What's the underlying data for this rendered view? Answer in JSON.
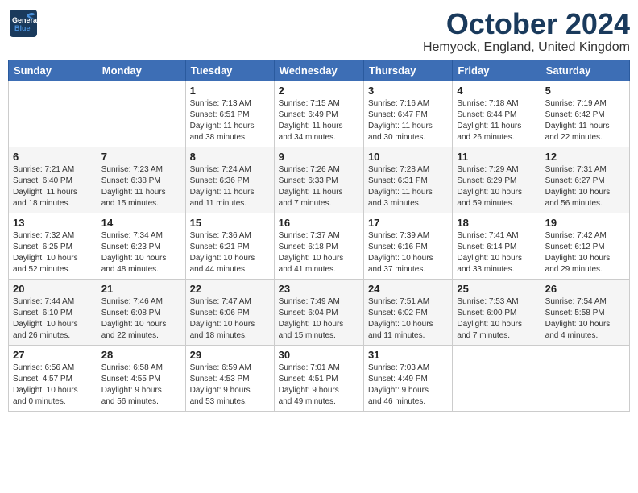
{
  "header": {
    "logo_line1": "General",
    "logo_line2": "Blue",
    "month": "October 2024",
    "location": "Hemyock, England, United Kingdom"
  },
  "weekdays": [
    "Sunday",
    "Monday",
    "Tuesday",
    "Wednesday",
    "Thursday",
    "Friday",
    "Saturday"
  ],
  "weeks": [
    [
      {
        "day": "",
        "details": ""
      },
      {
        "day": "",
        "details": ""
      },
      {
        "day": "1",
        "details": "Sunrise: 7:13 AM\nSunset: 6:51 PM\nDaylight: 11 hours\nand 38 minutes."
      },
      {
        "day": "2",
        "details": "Sunrise: 7:15 AM\nSunset: 6:49 PM\nDaylight: 11 hours\nand 34 minutes."
      },
      {
        "day": "3",
        "details": "Sunrise: 7:16 AM\nSunset: 6:47 PM\nDaylight: 11 hours\nand 30 minutes."
      },
      {
        "day": "4",
        "details": "Sunrise: 7:18 AM\nSunset: 6:44 PM\nDaylight: 11 hours\nand 26 minutes."
      },
      {
        "day": "5",
        "details": "Sunrise: 7:19 AM\nSunset: 6:42 PM\nDaylight: 11 hours\nand 22 minutes."
      }
    ],
    [
      {
        "day": "6",
        "details": "Sunrise: 7:21 AM\nSunset: 6:40 PM\nDaylight: 11 hours\nand 18 minutes."
      },
      {
        "day": "7",
        "details": "Sunrise: 7:23 AM\nSunset: 6:38 PM\nDaylight: 11 hours\nand 15 minutes."
      },
      {
        "day": "8",
        "details": "Sunrise: 7:24 AM\nSunset: 6:36 PM\nDaylight: 11 hours\nand 11 minutes."
      },
      {
        "day": "9",
        "details": "Sunrise: 7:26 AM\nSunset: 6:33 PM\nDaylight: 11 hours\nand 7 minutes."
      },
      {
        "day": "10",
        "details": "Sunrise: 7:28 AM\nSunset: 6:31 PM\nDaylight: 11 hours\nand 3 minutes."
      },
      {
        "day": "11",
        "details": "Sunrise: 7:29 AM\nSunset: 6:29 PM\nDaylight: 10 hours\nand 59 minutes."
      },
      {
        "day": "12",
        "details": "Sunrise: 7:31 AM\nSunset: 6:27 PM\nDaylight: 10 hours\nand 56 minutes."
      }
    ],
    [
      {
        "day": "13",
        "details": "Sunrise: 7:32 AM\nSunset: 6:25 PM\nDaylight: 10 hours\nand 52 minutes."
      },
      {
        "day": "14",
        "details": "Sunrise: 7:34 AM\nSunset: 6:23 PM\nDaylight: 10 hours\nand 48 minutes."
      },
      {
        "day": "15",
        "details": "Sunrise: 7:36 AM\nSunset: 6:21 PM\nDaylight: 10 hours\nand 44 minutes."
      },
      {
        "day": "16",
        "details": "Sunrise: 7:37 AM\nSunset: 6:18 PM\nDaylight: 10 hours\nand 41 minutes."
      },
      {
        "day": "17",
        "details": "Sunrise: 7:39 AM\nSunset: 6:16 PM\nDaylight: 10 hours\nand 37 minutes."
      },
      {
        "day": "18",
        "details": "Sunrise: 7:41 AM\nSunset: 6:14 PM\nDaylight: 10 hours\nand 33 minutes."
      },
      {
        "day": "19",
        "details": "Sunrise: 7:42 AM\nSunset: 6:12 PM\nDaylight: 10 hours\nand 29 minutes."
      }
    ],
    [
      {
        "day": "20",
        "details": "Sunrise: 7:44 AM\nSunset: 6:10 PM\nDaylight: 10 hours\nand 26 minutes."
      },
      {
        "day": "21",
        "details": "Sunrise: 7:46 AM\nSunset: 6:08 PM\nDaylight: 10 hours\nand 22 minutes."
      },
      {
        "day": "22",
        "details": "Sunrise: 7:47 AM\nSunset: 6:06 PM\nDaylight: 10 hours\nand 18 minutes."
      },
      {
        "day": "23",
        "details": "Sunrise: 7:49 AM\nSunset: 6:04 PM\nDaylight: 10 hours\nand 15 minutes."
      },
      {
        "day": "24",
        "details": "Sunrise: 7:51 AM\nSunset: 6:02 PM\nDaylight: 10 hours\nand 11 minutes."
      },
      {
        "day": "25",
        "details": "Sunrise: 7:53 AM\nSunset: 6:00 PM\nDaylight: 10 hours\nand 7 minutes."
      },
      {
        "day": "26",
        "details": "Sunrise: 7:54 AM\nSunset: 5:58 PM\nDaylight: 10 hours\nand 4 minutes."
      }
    ],
    [
      {
        "day": "27",
        "details": "Sunrise: 6:56 AM\nSunset: 4:57 PM\nDaylight: 10 hours\nand 0 minutes."
      },
      {
        "day": "28",
        "details": "Sunrise: 6:58 AM\nSunset: 4:55 PM\nDaylight: 9 hours\nand 56 minutes."
      },
      {
        "day": "29",
        "details": "Sunrise: 6:59 AM\nSunset: 4:53 PM\nDaylight: 9 hours\nand 53 minutes."
      },
      {
        "day": "30",
        "details": "Sunrise: 7:01 AM\nSunset: 4:51 PM\nDaylight: 9 hours\nand 49 minutes."
      },
      {
        "day": "31",
        "details": "Sunrise: 7:03 AM\nSunset: 4:49 PM\nDaylight: 9 hours\nand 46 minutes."
      },
      {
        "day": "",
        "details": ""
      },
      {
        "day": "",
        "details": ""
      }
    ]
  ]
}
